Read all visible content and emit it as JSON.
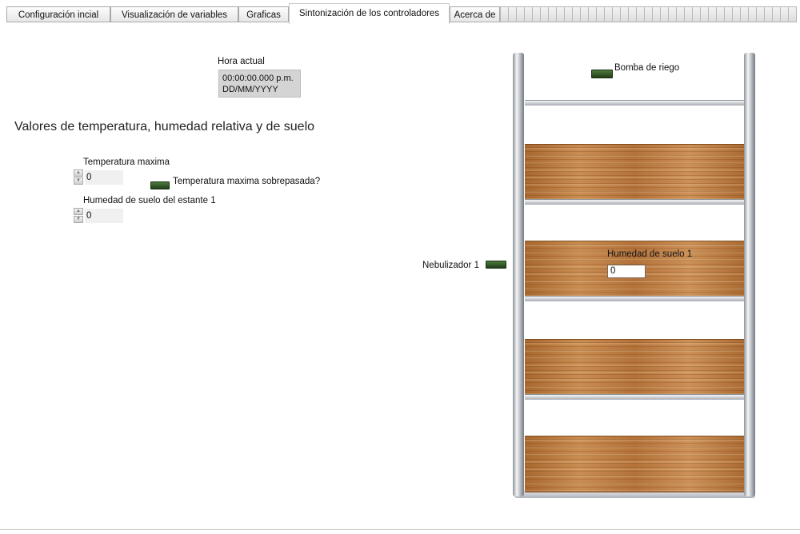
{
  "tabs": [
    {
      "label": "Configuración incial"
    },
    {
      "label": "Visualización de variables"
    },
    {
      "label": "Graficas"
    },
    {
      "label": "Sintonización de los controladores",
      "active": true
    },
    {
      "label": "Acerca de"
    }
  ],
  "clock": {
    "label": "Hora actual",
    "time": "00:00:00.000 p.m.",
    "date": "DD/MM/YYYY"
  },
  "section": {
    "title": "Valores de temperatura, humedad relativa y de suelo"
  },
  "temperature": {
    "label": "Temperatura maxima",
    "value": "0",
    "exceeded_label": "Temperatura maxima sobrepasada?"
  },
  "shelf_soil": {
    "label": "Humedad de suelo del estante 1",
    "value": "0"
  },
  "indicators": {
    "pump_label": "Bomba de riego",
    "nebulizer_label": "Nebulizador 1",
    "led_color_off": "#2f5a24"
  },
  "rack": {
    "soil_label": "Humedad de suelo 1",
    "soil_value": "0"
  }
}
